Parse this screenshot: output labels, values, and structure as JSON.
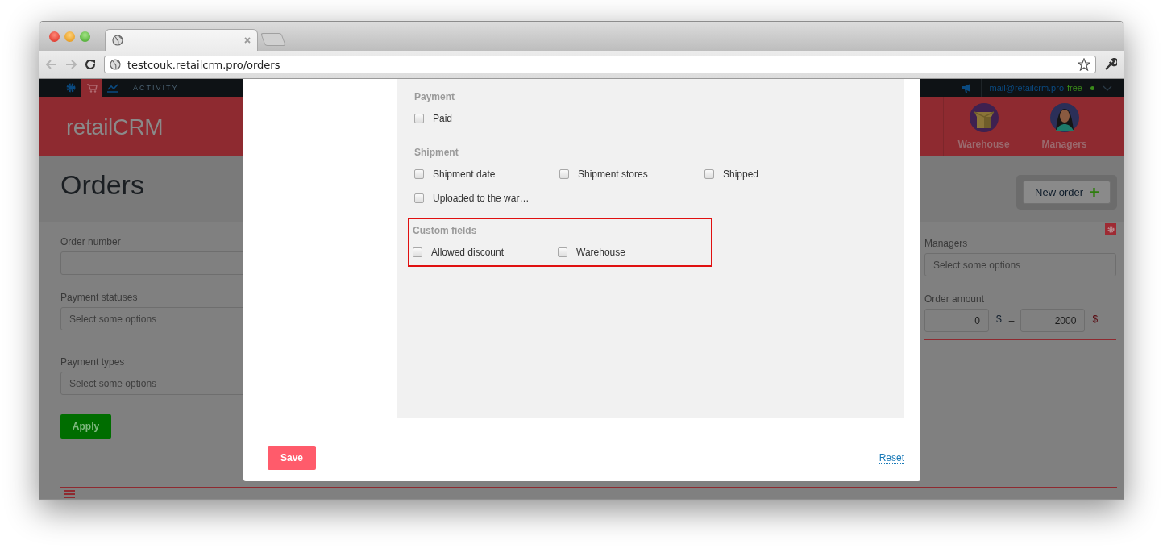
{
  "browser": {
    "url": "testcouk.retailcrm.pro/orders"
  },
  "topbar": {
    "items": [
      {
        "kind": "gear",
        "selected": false
      },
      {
        "kind": "cart",
        "selected": true
      },
      {
        "kind": "chart",
        "selected": false
      }
    ],
    "activity_label": "ACTIVITY",
    "email": "mail@retailcrm.pro",
    "plan": "free"
  },
  "header": {
    "logo": "retailCRM",
    "nav": [
      {
        "kind": "box",
        "label": "Warehouse"
      },
      {
        "kind": "person",
        "label": "Managers"
      }
    ]
  },
  "page": {
    "title": "Orders",
    "new_order_button": "New order",
    "filters_left": [
      {
        "label": "Order number"
      },
      {
        "label": "Payment statuses",
        "placeholder": "Select some options"
      },
      {
        "label": "Payment types",
        "placeholder": "Select some options"
      }
    ],
    "apply_button": "Apply",
    "managers": {
      "label": "Managers",
      "placeholder": "Select some options"
    },
    "order_amount": {
      "label": "Order amount",
      "from": "0",
      "to": "2000",
      "currency": "$",
      "separator": "–"
    }
  },
  "modal": {
    "sections": [
      {
        "title": "Payment",
        "highlighted": false,
        "options": [
          {
            "label": "Paid",
            "checked": false
          }
        ]
      },
      {
        "title": "Shipment",
        "highlighted": false,
        "options": [
          {
            "label": "Shipment date",
            "checked": false
          },
          {
            "label": "Shipment stores",
            "checked": false
          },
          {
            "label": "Shipped",
            "checked": false
          },
          {
            "label": "Uploaded to the war…",
            "checked": false
          }
        ]
      },
      {
        "title": "Custom fields",
        "highlighted": true,
        "options": [
          {
            "label": "Allowed discount",
            "checked": false
          },
          {
            "label": "Warehouse",
            "checked": false
          }
        ]
      }
    ],
    "save_button": "Save",
    "reset_link": "Reset"
  }
}
